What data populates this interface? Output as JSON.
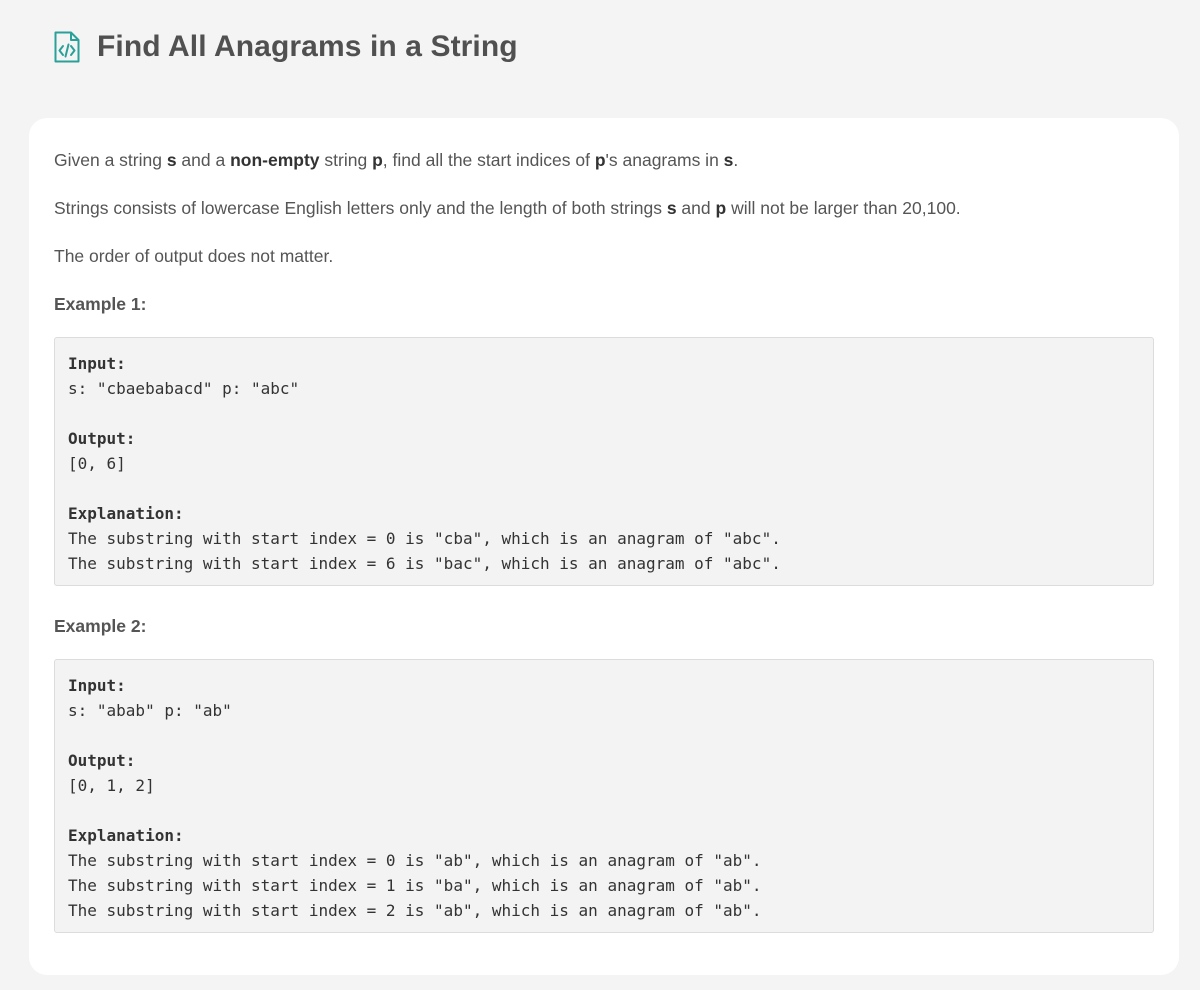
{
  "page": {
    "title": "Find All Anagrams in a String",
    "icon": "code-file-icon",
    "accent_color": "#2aa198"
  },
  "problem": {
    "p1": {
      "t1": "Given a string ",
      "b1": "s",
      "t2": " and a ",
      "b2": "non-empty",
      "t3": " string ",
      "b3": "p",
      "t4": ", find all the start indices of ",
      "b4": "p",
      "t5": "'s anagrams in ",
      "b5": "s",
      "t6": "."
    },
    "p2": {
      "t1": "Strings consists of lowercase English letters only and the length of both strings ",
      "b1": "s",
      "t2": " and ",
      "b2": "p",
      "t3": " will not be larger than 20,100."
    },
    "p3": "The order of output does not matter."
  },
  "examples": [
    {
      "heading": "Example 1:",
      "input_label": "Input:",
      "input_value": "s: \"cbaebabacd\" p: \"abc\"",
      "output_label": "Output:",
      "output_value": "[0, 6]",
      "explanation_label": "Explanation:",
      "explanation_lines": [
        "The substring with start index = 0 is \"cba\", which is an anagram of \"abc\".",
        "The substring with start index = 6 is \"bac\", which is an anagram of \"abc\"."
      ]
    },
    {
      "heading": "Example 2:",
      "input_label": "Input:",
      "input_value": "s: \"abab\" p: \"ab\"",
      "output_label": "Output:",
      "output_value": "[0, 1, 2]",
      "explanation_label": "Explanation:",
      "explanation_lines": [
        "The substring with start index = 0 is \"ab\", which is an anagram of \"ab\".",
        "The substring with start index = 1 is \"ba\", which is an anagram of \"ab\".",
        "The substring with start index = 2 is \"ab\", which is an anagram of \"ab\"."
      ]
    }
  ]
}
